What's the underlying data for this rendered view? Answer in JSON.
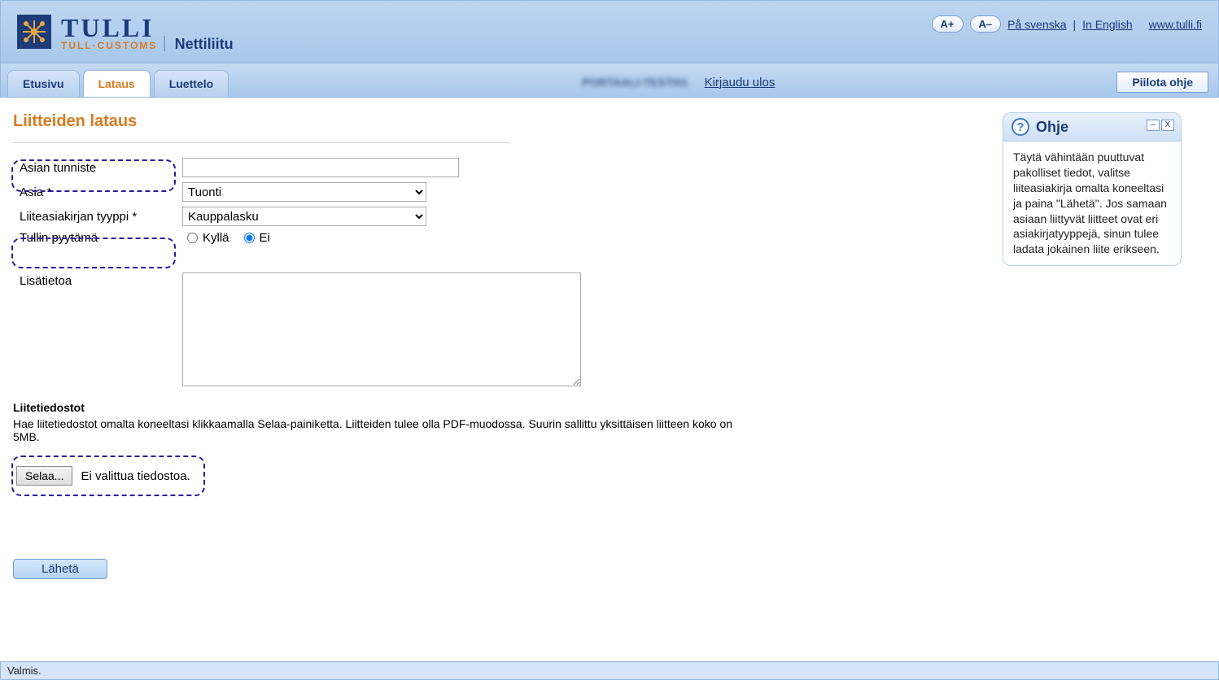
{
  "header": {
    "logo_main": "TULLI",
    "logo_sub": "TULL·CUSTOMS",
    "app_name": "Nettiliitu",
    "font_plus": "A+",
    "font_minus": "A–",
    "lang_sv": "På svenska",
    "lang_en": "In English",
    "site_link": "www.tulli.fi"
  },
  "nav": {
    "tabs": [
      {
        "label": "Etusivu",
        "active": false
      },
      {
        "label": "Lataus",
        "active": true
      },
      {
        "label": "Luettelo",
        "active": false
      }
    ],
    "user_text": "PORTAALI-TESTI01",
    "logout": "Kirjaudu ulos",
    "hide_help": "Piilota ohje"
  },
  "page": {
    "title": "Liitteiden lataus",
    "fields": {
      "asian_tunniste": {
        "label": "Asian tunniste",
        "value": ""
      },
      "asia": {
        "label": "Asia *",
        "value": "Tuonti"
      },
      "liiteasiakirjan_tyyppi": {
        "label": "Liiteasiakirjan tyyppi *",
        "value": "Kauppalasku"
      },
      "tullin_pyytama": {
        "label": "Tullin pyytämä",
        "yes": "Kyllä",
        "no": "Ei",
        "selected": "Ei"
      },
      "lisatietoa": {
        "label": "Lisätietoa",
        "value": ""
      }
    },
    "files": {
      "title": "Liitetiedostot",
      "desc": "Hae liitetiedostot omalta koneeltasi klikkaamalla Selaa-painiketta. Liitteiden tulee olla PDF-muodossa. Suurin sallittu yksittäisen liitteen koko on 5MB.",
      "browse": "Selaa...",
      "no_file": "Ei valittua tiedostoa."
    },
    "submit": "Lähetä"
  },
  "help": {
    "title": "Ohje",
    "body": "Täytä vähintään puuttuvat pakolliset tiedot, valitse liiteasiakirja omalta koneeltasi ja paina \"Lähetä\". Jos samaan asiaan liittyvät liitteet ovat eri asiakirjatyyppejä, sinun tulee ladata jokainen liite erikseen."
  },
  "status": "Valmis."
}
